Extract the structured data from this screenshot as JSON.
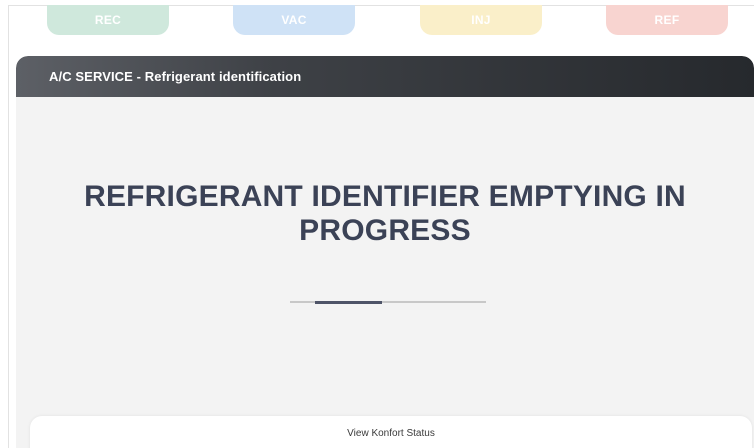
{
  "phases": [
    {
      "label": "REC",
      "color": "#cfe8dc"
    },
    {
      "label": "VAC",
      "color": "#cfe2f6"
    },
    {
      "label": "INJ",
      "color": "#faefc9"
    },
    {
      "label": "REF",
      "color": "#f8d4d0"
    }
  ],
  "panel": {
    "title": "A/C SERVICE - Refrigerant identification",
    "message": "REFRIGERANT IDENTIFIER EMPTYING IN PROGRESS",
    "progress_fraction": 0.34,
    "progress_offset_fraction": 0.13
  },
  "footer": {
    "status_link_label": "View Konfort Status"
  },
  "colors": {
    "header_dark": "#26292d",
    "message_text": "#3b4256",
    "panel_bg": "#f3f3f3",
    "progress_fill": "#4e5468"
  }
}
